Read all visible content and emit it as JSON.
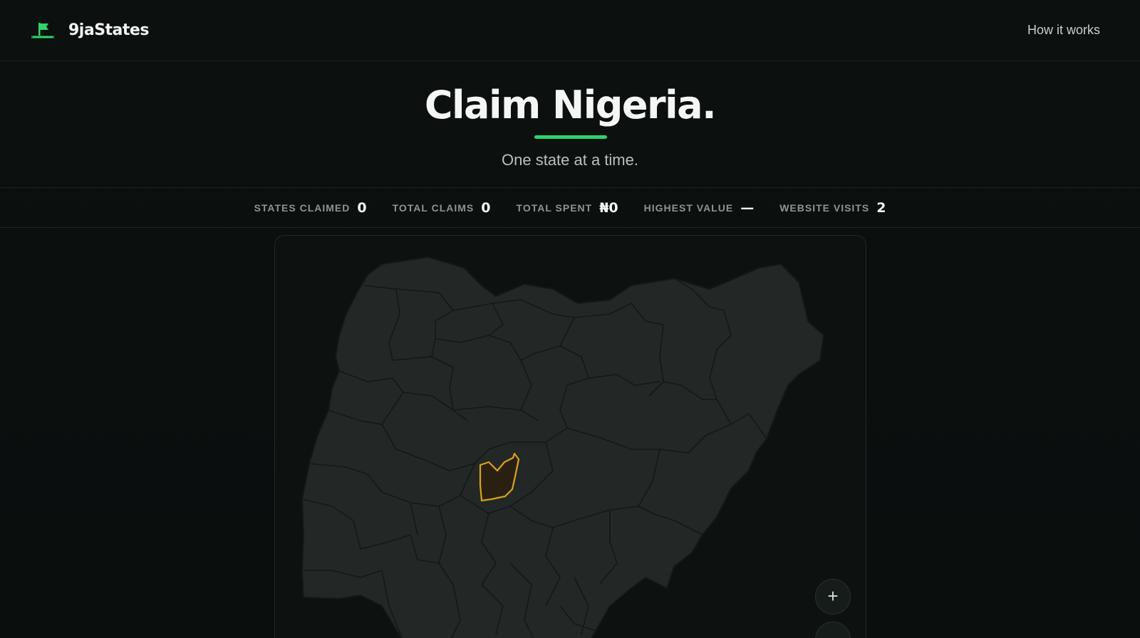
{
  "header": {
    "brand_name": "9jaStates",
    "nav_how_it_works": "How it works"
  },
  "hero": {
    "title": "Claim Nigeria.",
    "subtitle": "One state at a time."
  },
  "stats": [
    {
      "label": "STATES CLAIMED",
      "value": "0"
    },
    {
      "label": "TOTAL CLAIMS",
      "value": "0"
    },
    {
      "label": "TOTAL SPENT",
      "value": "₦0"
    },
    {
      "label": "HIGHEST VALUE",
      "value": "—"
    },
    {
      "label": "WEBSITE VISITS",
      "value": "2"
    }
  ],
  "map": {
    "zoom_in_label": "+",
    "zoom_out_label": "−"
  },
  "colors": {
    "accent_green": "#2fd36b",
    "highlight_gold": "#d9a21b",
    "state_fill": "#232826",
    "state_border": "#141917",
    "highlight_fill": "#2a2012"
  },
  "icons": {
    "brand": "flag-icon"
  }
}
